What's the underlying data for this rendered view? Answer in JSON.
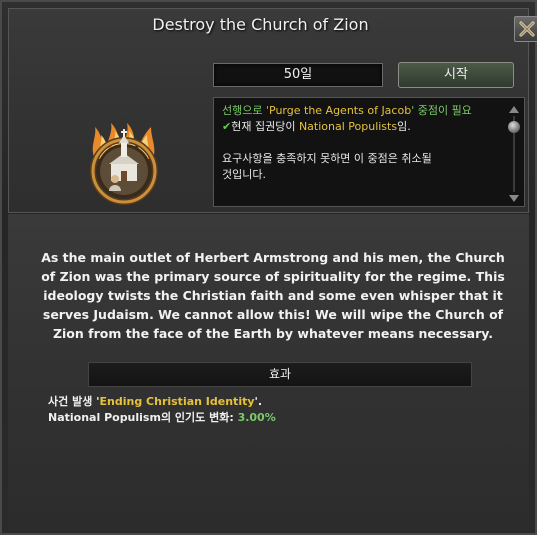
{
  "window": {
    "title": "Destroy the Church of Zion"
  },
  "focus": {
    "days": "50일",
    "start_label": "시작"
  },
  "requirements": {
    "prereq_prefix": "선행으로 '",
    "prereq_name": "Purge the Agents of Jacob",
    "prereq_suffix": "' 중점이 필요",
    "ruling_prefix": "현재 집권당이 ",
    "ruling_party": "National Populists",
    "ruling_suffix": "임.",
    "cancel_note_1": "요구사항을 충족하지 못하면 이 중점은 취소될",
    "cancel_note_2": "것입니다."
  },
  "description": "As the main outlet of Herbert Armstrong and his men, the Church of Zion was the primary source of spirituality for the regime. This ideology twists the Christian faith and some even whisper that it serves Judaism. We cannot allow this! We will wipe the Church of Zion from the face of the Earth by whatever means necessary.",
  "effects": {
    "header": "효과",
    "event_prefix": "사건 발생 '",
    "event_name": "Ending Christian Identity",
    "event_suffix": "'.",
    "popularity_prefix": "National Populism의 인기도 변화: ",
    "popularity_value": "3.00%"
  },
  "icons": {
    "close": "close-x-icon",
    "check": "checkmark-icon",
    "emblem": "burning-church-emblem-icon"
  },
  "colors": {
    "highlight_yellow": "#e6c23a",
    "highlight_green": "#7cc96a",
    "check_green": "#5fcf4a"
  }
}
